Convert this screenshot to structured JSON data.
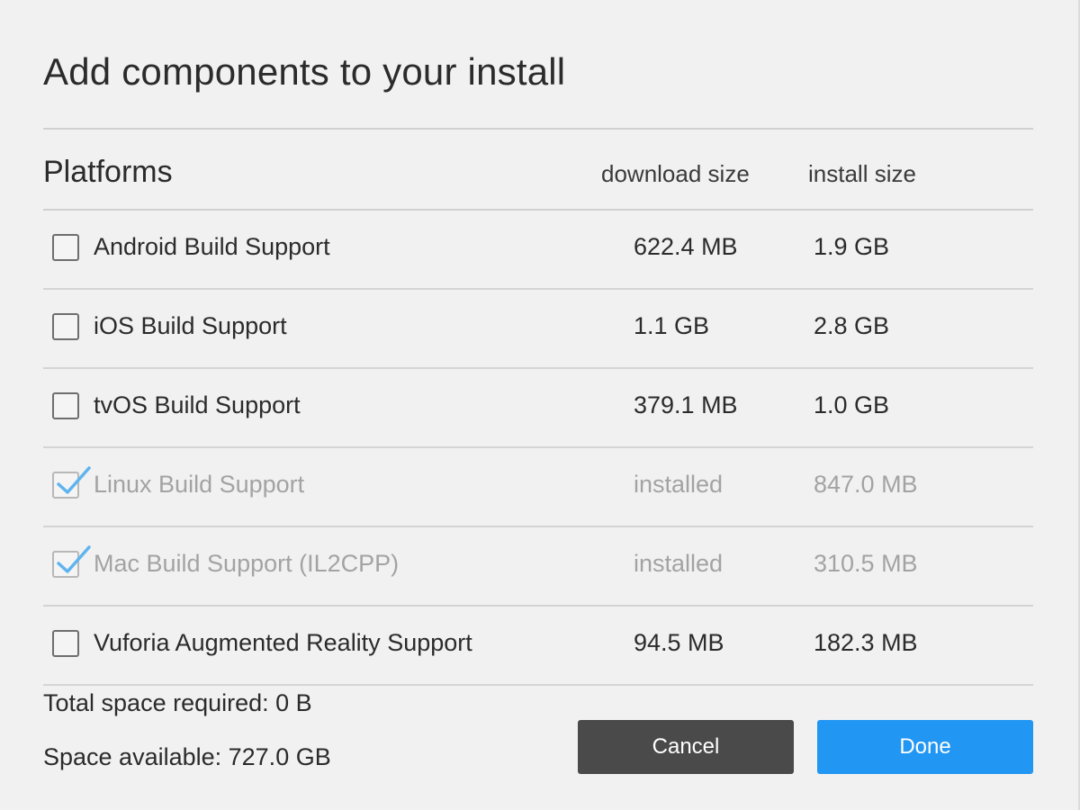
{
  "dialog": {
    "title": "Add components to your install"
  },
  "header": {
    "section": "Platforms",
    "download_col": "download size",
    "install_col": "install size"
  },
  "components": [
    {
      "name": "Android Build Support",
      "download": "622.4 MB",
      "install": "1.9 GB",
      "checked": false,
      "installed": false
    },
    {
      "name": "iOS Build Support",
      "download": "1.1 GB",
      "install": "2.8 GB",
      "checked": false,
      "installed": false
    },
    {
      "name": "tvOS Build Support",
      "download": "379.1 MB",
      "install": "1.0 GB",
      "checked": false,
      "installed": false
    },
    {
      "name": "Linux Build Support",
      "download": "installed",
      "install": "847.0 MB",
      "checked": true,
      "installed": true
    },
    {
      "name": "Mac Build Support (IL2CPP)",
      "download": "installed",
      "install": "310.5 MB",
      "checked": true,
      "installed": true
    },
    {
      "name": "Vuforia Augmented Reality Support",
      "download": "94.5 MB",
      "install": "182.3 MB",
      "checked": false,
      "installed": false
    }
  ],
  "footer": {
    "total_required": "Total space required: 0 B",
    "space_available": "Space available: 727.0 GB",
    "cancel_label": "Cancel",
    "done_label": "Done"
  },
  "colors": {
    "background": "#f1f1f1",
    "cancel_button": "#4a4a4a",
    "done_button": "#2196f3",
    "checkmark": "#5fb4f0",
    "installed_text": "#a3a3a3"
  }
}
